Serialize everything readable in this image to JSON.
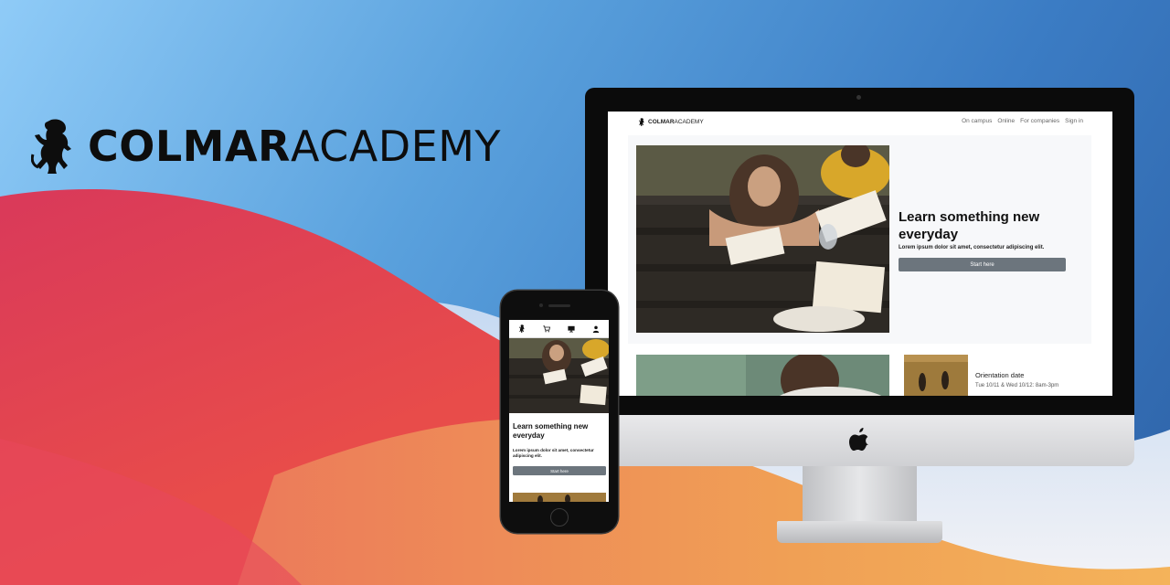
{
  "logo": {
    "bold": "COLMAR",
    "light": "ACADEMY",
    "icon": "lion-rampant-icon"
  },
  "colors": {
    "bg_top": "#5aa1dd",
    "wave_red": "#e0404e",
    "wave_orange": "#ef9a58",
    "button_gray": "#6c757d"
  },
  "desktop": {
    "brand_bold": "COLMAR",
    "brand_light": "ACADEMY",
    "nav": [
      "On campus",
      "Online",
      "For companies",
      "Sign in"
    ],
    "hero_title": "Learn something new everyday",
    "hero_text": "Lorem ipsum dolor sit amet, consectetur adipiscing elit.",
    "hero_button": "Start here",
    "card_title": "Orientation date",
    "card_date": "Tue 10/11 & Wed 10/12: 8am-3pm"
  },
  "mobile": {
    "nav_icons": [
      "lion-icon",
      "cart-icon",
      "monitor-icon",
      "user-icon"
    ],
    "hero_title": "Learn something new everyday",
    "hero_text": "Lorem ipsum dolor sit amet, consectetur adipiscing elit.",
    "hero_button": "Start here"
  }
}
